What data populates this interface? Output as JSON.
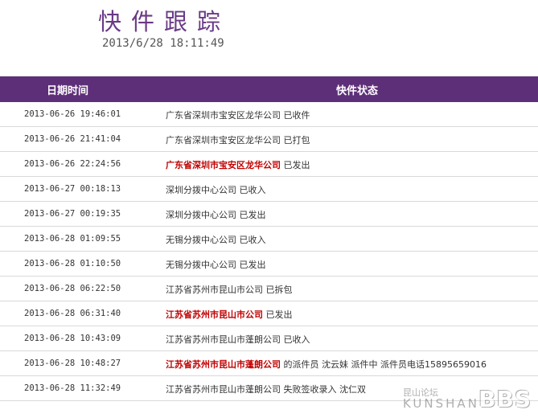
{
  "header": {
    "title": "快件跟踪",
    "datetime": "2013/6/28 18:11:49"
  },
  "table": {
    "columns": [
      "日期时间",
      "快件状态"
    ],
    "rows": [
      {
        "time": "2013-06-26 19:46:01",
        "location": "广东省深圳市宝安区龙华公司",
        "highlight": false,
        "status": "已收件"
      },
      {
        "time": "2013-06-26 21:41:04",
        "location": "广东省深圳市宝安区龙华公司",
        "highlight": false,
        "status": "已打包"
      },
      {
        "time": "2013-06-26 22:24:56",
        "location": "广东省深圳市宝安区龙华公司",
        "highlight": true,
        "status": "已发出"
      },
      {
        "time": "2013-06-27 00:18:13",
        "location": "深圳分拨中心公司",
        "highlight": false,
        "status": "已收入"
      },
      {
        "time": "2013-06-27 00:19:35",
        "location": "深圳分拨中心公司",
        "highlight": false,
        "status": "已发出"
      },
      {
        "time": "2013-06-28 01:09:55",
        "location": "无锡分拨中心公司",
        "highlight": false,
        "status": "已收入"
      },
      {
        "time": "2013-06-28 01:10:50",
        "location": "无锡分拨中心公司",
        "highlight": false,
        "status": "已发出"
      },
      {
        "time": "2013-06-28 06:22:50",
        "location": "江苏省苏州市昆山市公司",
        "highlight": false,
        "status": "已拆包"
      },
      {
        "time": "2013-06-28 06:31:40",
        "location": "江苏省苏州市昆山市公司",
        "highlight": true,
        "status": "已发出"
      },
      {
        "time": "2013-06-28 10:43:09",
        "location": "江苏省苏州市昆山市蓬朗公司",
        "highlight": false,
        "status": "已收入"
      },
      {
        "time": "2013-06-28 10:48:27",
        "location": "江苏省苏州市昆山市蓬朗公司",
        "highlight": true,
        "status": "的派件员 沈云妹 派件中 派件员电话15895659016"
      },
      {
        "time": "2013-06-28 11:32:49",
        "location": "江苏省苏州市昆山市蓬朗公司",
        "highlight": false,
        "status": "失败签收录入 沈仁双"
      }
    ]
  },
  "watermark": {
    "cn": "昆山论坛",
    "en": "KUNSHAN",
    "bbs": "BBS"
  },
  "colors": {
    "header_bar": "#5e2f79",
    "title": "#6a3a86",
    "highlight": "#c00000"
  }
}
